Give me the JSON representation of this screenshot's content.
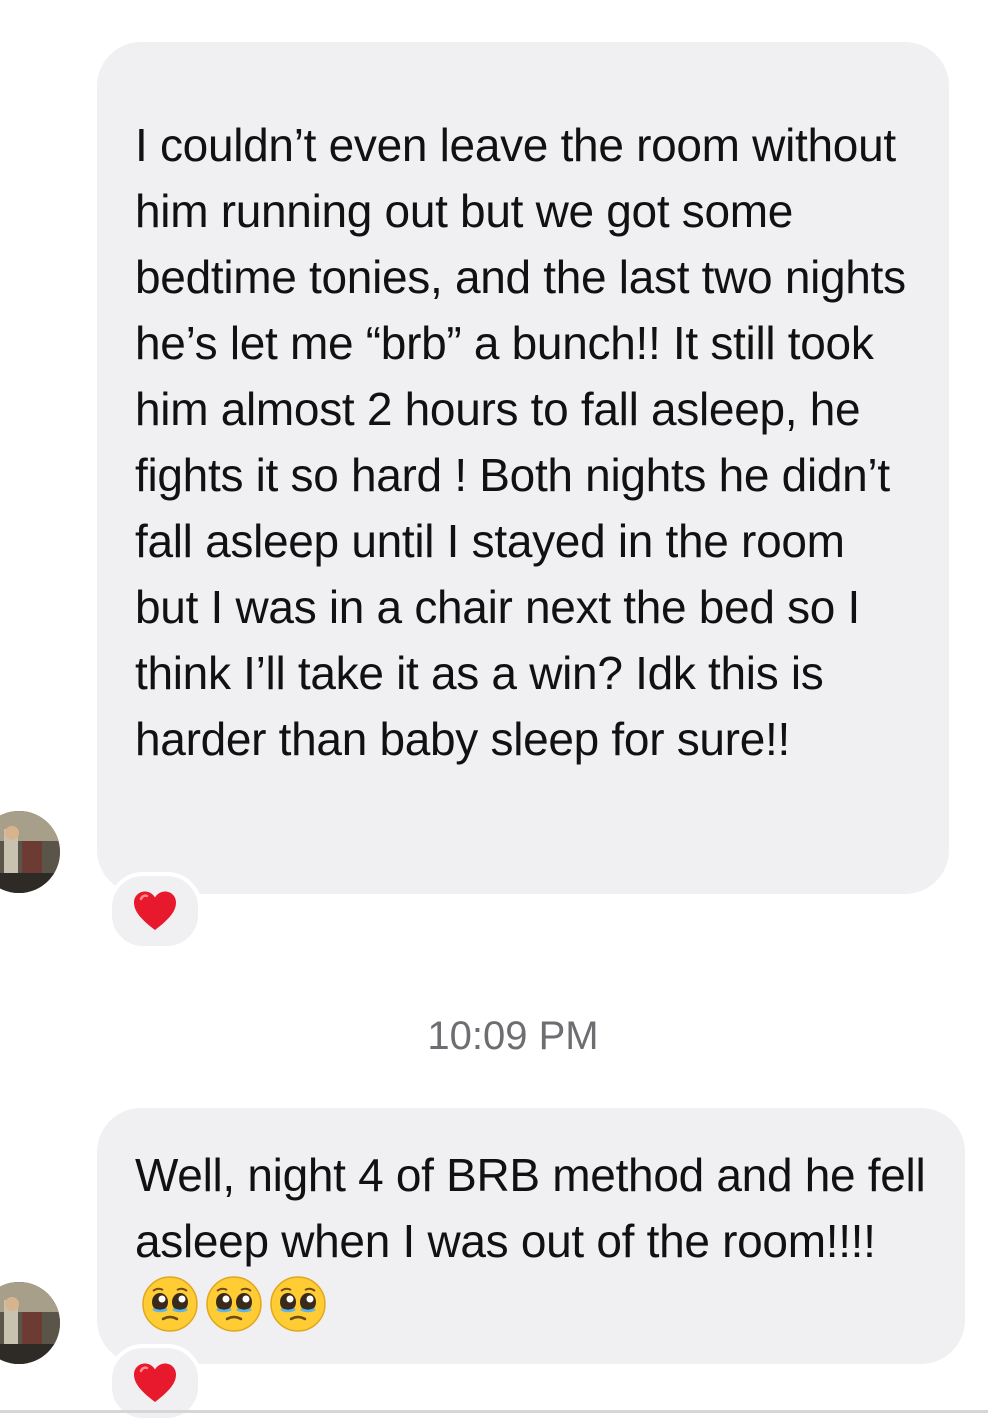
{
  "messages": [
    {
      "text": "I couldn’t even leave the room without him running out but we got some bedtime tonies, and the last two nights he’s let me “brb” a bunch!! It still took him almost 2 hours to fall asleep, he fights it so hard ! Both nights he didn’t fall asleep until I stayed in the room but I was in a chair next the bed so I think I’ll take it as a win? Idk this is harder than baby sleep for sure!!",
      "reaction": "red-heart-icon"
    },
    {
      "text": "Well, night 4 of BRB method and he fell asleep when I was out of the room!!!!",
      "emojis": [
        "pleading-face-icon",
        "pleading-face-icon",
        "pleading-face-icon"
      ],
      "reaction": "red-heart-icon"
    }
  ],
  "timestamp": "10:09 PM",
  "colors": {
    "bubble": "#f0f0f2",
    "text": "#111111",
    "timestamp": "#6d6d72",
    "heart": "#e8192c"
  }
}
